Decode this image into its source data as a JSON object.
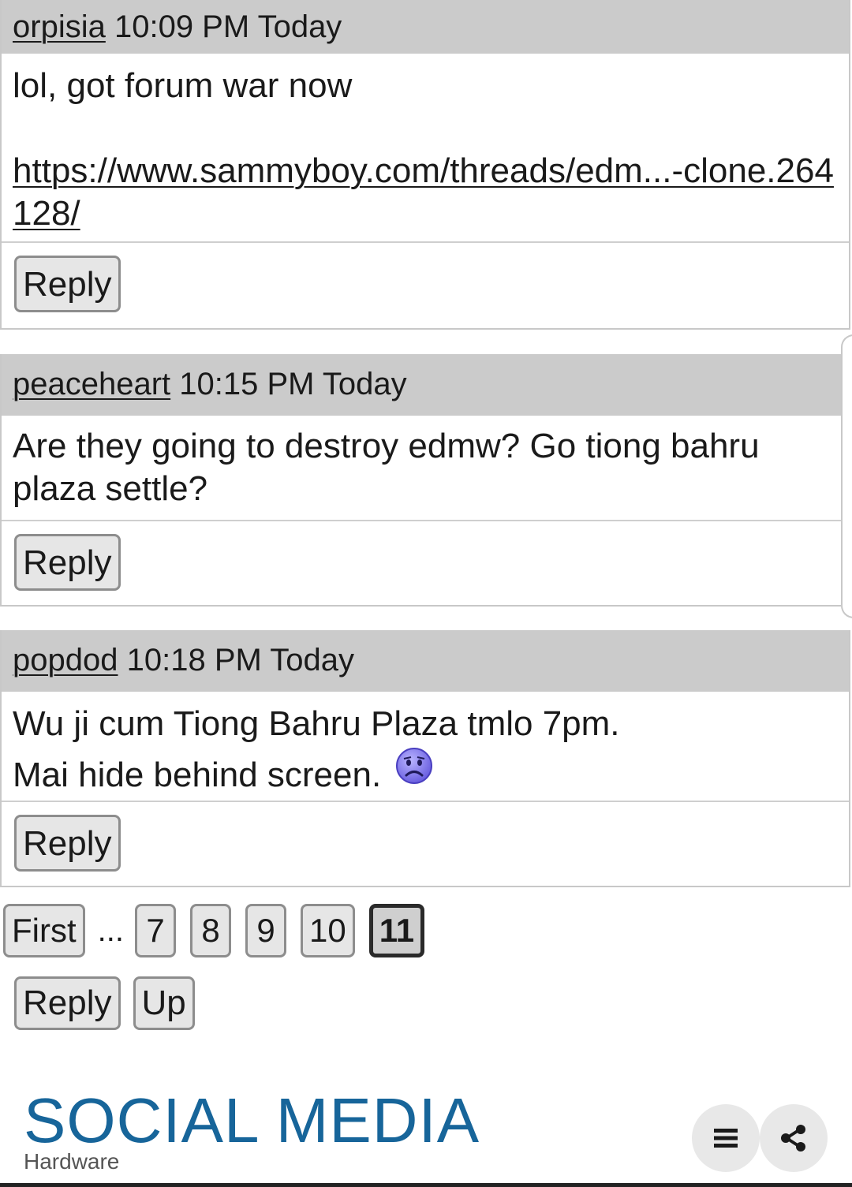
{
  "posts": [
    {
      "username": "orpisia",
      "time": "10:09 PM Today",
      "body_line1": "lol, got forum war now",
      "link": "https://www.sammyboy.com/threads/edm...-clone.264128/",
      "reply_label": "Reply"
    },
    {
      "username": "peaceheart",
      "time": "10:15 PM Today",
      "body_line1": "Are they going to destroy edmw? Go tiong bahru plaza settle?",
      "reply_label": "Reply"
    },
    {
      "username": "popdod",
      "time": "10:18 PM Today",
      "body_line1": "Wu ji cum Tiong Bahru Plaza tmlo 7pm.",
      "body_line2": "Mai hide behind screen.",
      "emoji": "sad-face-emoji",
      "reply_label": "Reply"
    }
  ],
  "pagination": {
    "first_label": "First",
    "ellipsis": "...",
    "pages": [
      "7",
      "8",
      "9",
      "10"
    ],
    "current_page": "11"
  },
  "actions": {
    "reply_label": "Reply",
    "up_label": "Up"
  },
  "footer": {
    "brand_title": "SOCIAL MEDIA",
    "brand_subtitle": "Hardware",
    "brand_color": "#17659a",
    "menu_icon": "menu-icon",
    "share_icon": "share-icon"
  }
}
